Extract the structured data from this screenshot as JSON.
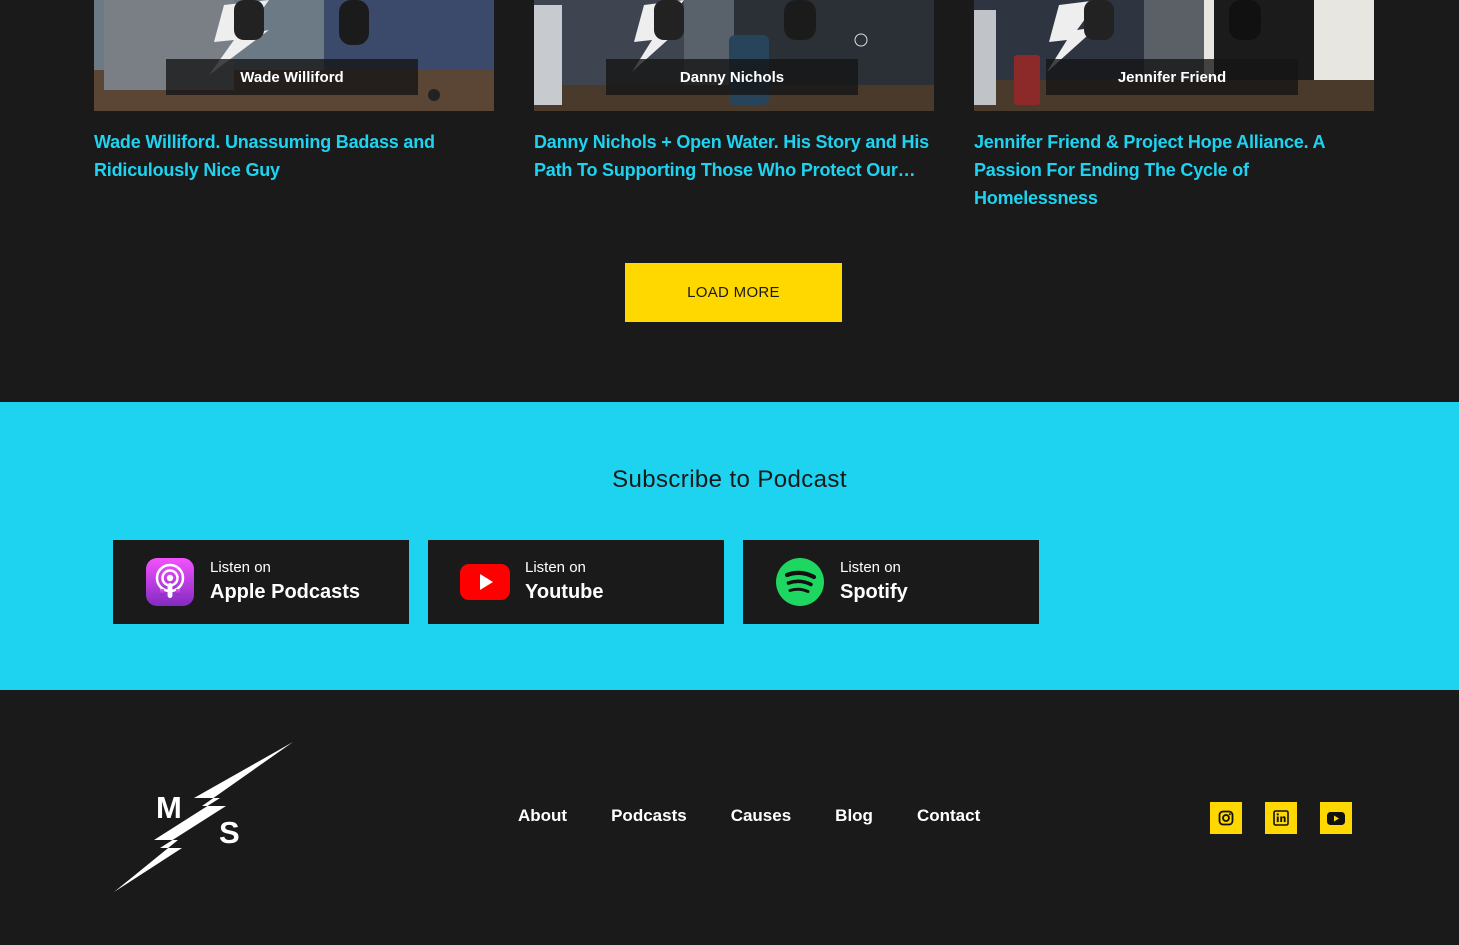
{
  "episodes": [
    {
      "guest": "Wade Williford",
      "title": "Wade Williford. Unassuming Badass and Ridiculously Nice Guy"
    },
    {
      "guest": "Danny Nichols",
      "title": "Danny Nichols + Open Water. His Story and His Path To Supporting Those Who Protect Our…"
    },
    {
      "guest": "Jennifer Friend",
      "title": "Jennifer Friend & Project Hope Alliance. A Passion For Ending The Cycle of Homelessness"
    }
  ],
  "load_more_label": "LOAD MORE",
  "subscribe": {
    "title": "Subscribe to Podcast",
    "platforms": [
      {
        "small": "Listen on",
        "name": "Apple Podcasts",
        "icon": "apple-podcasts-icon"
      },
      {
        "small": "Listen on",
        "name": "Youtube",
        "icon": "youtube-icon"
      },
      {
        "small": "Listen on",
        "name": "Spotify",
        "icon": "spotify-icon"
      }
    ]
  },
  "footer": {
    "logo_text": "MS",
    "nav": [
      "About",
      "Podcasts",
      "Causes",
      "Blog",
      "Contact"
    ],
    "social": [
      "instagram-icon",
      "linkedin-icon",
      "youtube-icon"
    ]
  },
  "colors": {
    "background": "#1a1a1a",
    "accent_cyan": "#1ed3f0",
    "accent_yellow": "#ffd800",
    "link_cyan": "#1fd3f0"
  }
}
